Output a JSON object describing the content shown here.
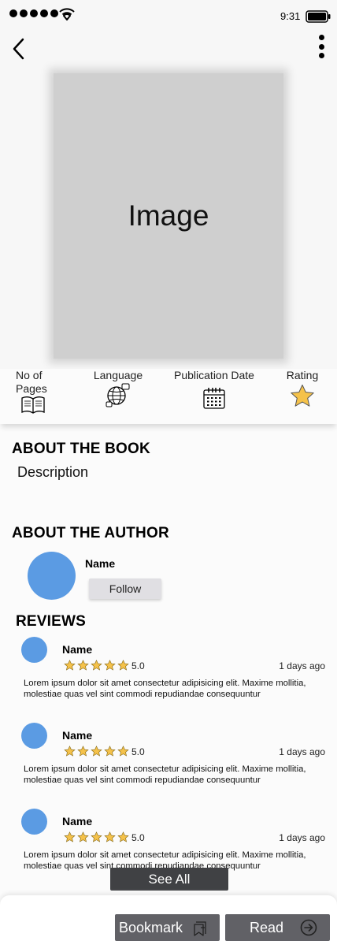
{
  "status_bar": {
    "time": "9:31"
  },
  "cover": {
    "placeholder": "Image"
  },
  "info": {
    "pages_label": "No of Pages",
    "language_label": "Language",
    "pubdate_label": "Publication Date",
    "rating_label": "Rating"
  },
  "about_book": {
    "title": "ABOUT THE BOOK",
    "description": "Description"
  },
  "about_author": {
    "title": "ABOUT THE AUTHOR",
    "name": "Name",
    "follow_label": "Follow"
  },
  "reviews": {
    "title": "REVIEWS",
    "items": [
      {
        "name": "Name",
        "stars": 5,
        "score": "5.0",
        "time": "1 days ago",
        "text": "Lorem ipsum dolor sit amet consectetur adipisicing elit. Maxime mollitia, molestiae quas vel sint commodi repudiandae consequuntur"
      },
      {
        "name": "Name",
        "stars": 5,
        "score": "5.0",
        "time": "1 days ago",
        "text": "Lorem ipsum dolor sit amet consectetur adipisicing elit. Maxime mollitia, molestiae quas vel sint commodi repudiandae consequuntur"
      },
      {
        "name": "Name",
        "stars": 5,
        "score": "5.0",
        "time": "1 days ago",
        "text": "Lorem ipsum dolor sit amet consectetur adipisicing elit. Maxime mollitia, molestiae quas vel sint commodi repudiandae consequuntur"
      }
    ],
    "see_all_label": "See All"
  },
  "actions": {
    "bookmark_label": "Bookmark",
    "read_label": "Read"
  },
  "colors": {
    "avatar": "#5b9be3",
    "star": "#f5c24a",
    "button_dark": "#616166"
  },
  "icons": [
    "signal-icon",
    "wifi-icon",
    "battery-icon",
    "back-icon",
    "more-icon",
    "book-icon",
    "globe-icon",
    "calendar-icon",
    "star-icon",
    "bookmark-icon",
    "arrow-right-icon"
  ]
}
